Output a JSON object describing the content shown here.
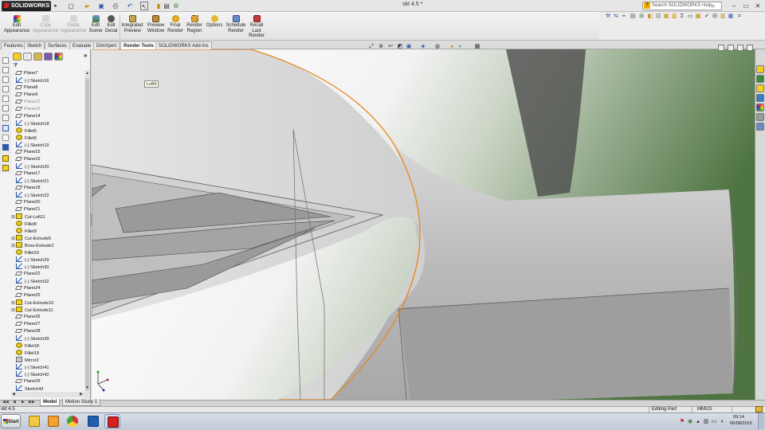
{
  "titlebar": {
    "app_name": "SOLIDWORKS",
    "doc_title": "skt 4.5 *",
    "search_placeholder": "Search SOLIDWORKS Help",
    "window_controls": [
      "minimize",
      "restore",
      "close"
    ]
  },
  "commands": [
    {
      "label": "Edit Appearance",
      "icon": "appearance-icon",
      "enabled": true
    },
    {
      "label": "Copy Appearance",
      "icon": "copy-appearance-icon",
      "enabled": false
    },
    {
      "label": "Paste Appearance",
      "icon": "paste-appearance-icon",
      "enabled": false
    },
    {
      "label": "Edit Scene",
      "icon": "scene-icon",
      "enabled": true
    },
    {
      "label": "Edit Decal",
      "icon": "decal-icon",
      "enabled": true
    },
    {
      "label": "Integrated Preview",
      "icon": "integrated-preview-icon",
      "enabled": true
    },
    {
      "label": "Preview Window",
      "icon": "preview-window-icon",
      "enabled": true
    },
    {
      "label": "Final Render",
      "icon": "final-render-icon",
      "enabled": true
    },
    {
      "label": "Render Region",
      "icon": "render-region-icon",
      "enabled": true
    },
    {
      "label": "Options",
      "icon": "options-icon",
      "enabled": true
    },
    {
      "label": "Schedule Render",
      "icon": "schedule-render-icon",
      "enabled": true
    },
    {
      "label": "Recall Last Render",
      "icon": "recall-render-icon",
      "enabled": true
    }
  ],
  "tabs": [
    "Features",
    "Sketch",
    "Surfaces",
    "Evaluate",
    "DimXpert",
    "Render Tools",
    "SOLIDWORKS Add-Ins"
  ],
  "active_tab": "Render Tools",
  "tree": [
    {
      "label": "Plane7",
      "type": "plane"
    },
    {
      "label": "(-) Sketch16",
      "type": "sketch"
    },
    {
      "label": "Plane8",
      "type": "plane"
    },
    {
      "label": "Plane9",
      "type": "plane"
    },
    {
      "label": "Plane12",
      "type": "plane",
      "grey": true
    },
    {
      "label": "Plane13",
      "type": "plane",
      "grey": true
    },
    {
      "label": "Plane14",
      "type": "plane"
    },
    {
      "label": "(-) Sketch18",
      "type": "sketch"
    },
    {
      "label": "Fillet5",
      "type": "fillet"
    },
    {
      "label": "Fillet6",
      "type": "fillet"
    },
    {
      "label": "(-) Sketch19",
      "type": "sketch"
    },
    {
      "label": "Plane15",
      "type": "plane"
    },
    {
      "label": "Plane16",
      "type": "plane"
    },
    {
      "label": "(-) Sketch20",
      "type": "sketch"
    },
    {
      "label": "Plane17",
      "type": "plane"
    },
    {
      "label": "(-) Sketch21",
      "type": "sketch"
    },
    {
      "label": "Plane18",
      "type": "plane"
    },
    {
      "label": "(-) Sketch22",
      "type": "sketch"
    },
    {
      "label": "Plane20",
      "type": "plane"
    },
    {
      "label": "Plane21",
      "type": "plane"
    },
    {
      "label": "Cut-Loft11",
      "type": "feat",
      "expandable": true
    },
    {
      "label": "Fillet8",
      "type": "fillet"
    },
    {
      "label": "Fillet9",
      "type": "fillet"
    },
    {
      "label": "Cut-Extrude5",
      "type": "feat",
      "expandable": true
    },
    {
      "label": "Boss-Extrude2",
      "type": "feat",
      "expandable": true
    },
    {
      "label": "Fillet10",
      "type": "fillet"
    },
    {
      "label": "(-) Sketch29",
      "type": "sketch"
    },
    {
      "label": "(-) Sketch30",
      "type": "sketch"
    },
    {
      "label": "Plane22",
      "type": "plane"
    },
    {
      "label": "(-) Sketch32",
      "type": "sketch"
    },
    {
      "label": "Plane24",
      "type": "plane"
    },
    {
      "label": "Plane25",
      "type": "plane"
    },
    {
      "label": "Cut-Extrude10",
      "type": "feat",
      "expandable": true
    },
    {
      "label": "Cut-Extrude11",
      "type": "feat",
      "expandable": true
    },
    {
      "label": "Plane26",
      "type": "plane"
    },
    {
      "label": "Plane27",
      "type": "plane"
    },
    {
      "label": "Plane28",
      "type": "plane"
    },
    {
      "label": "(-) Sketch39",
      "type": "sketch"
    },
    {
      "label": "Fillet18",
      "type": "fillet"
    },
    {
      "label": "Fillet19",
      "type": "fillet"
    },
    {
      "label": "Mirror2",
      "type": "mirror"
    },
    {
      "label": "(-) Sketch41",
      "type": "sketch"
    },
    {
      "label": "(-) Sketch42",
      "type": "sketch"
    },
    {
      "label": "Plane29",
      "type": "plane"
    },
    {
      "label": "Sketch43",
      "type": "sketch"
    }
  ],
  "viewport": {
    "tooltip": "Loft3",
    "edge_color": "#e8871e",
    "background_color": "#5a7a4a"
  },
  "bottom_tabs": [
    "Model",
    "Motion Study 1"
  ],
  "active_bottom_tab": "Model",
  "status": {
    "doc": "skt 4.5",
    "mode": "Editing Part",
    "units": "MMGS"
  },
  "taskbar": {
    "start_label": "Start",
    "apps": [
      "explorer-app",
      "media-player-app",
      "chrome-app",
      "outlook-app",
      "solidworks-app"
    ],
    "time": "09:14",
    "date": "06/08/2015"
  },
  "colors": {
    "accent": "#e8871e",
    "feature_yellow": "#f2cf21",
    "sketch_blue": "#3058a8"
  }
}
